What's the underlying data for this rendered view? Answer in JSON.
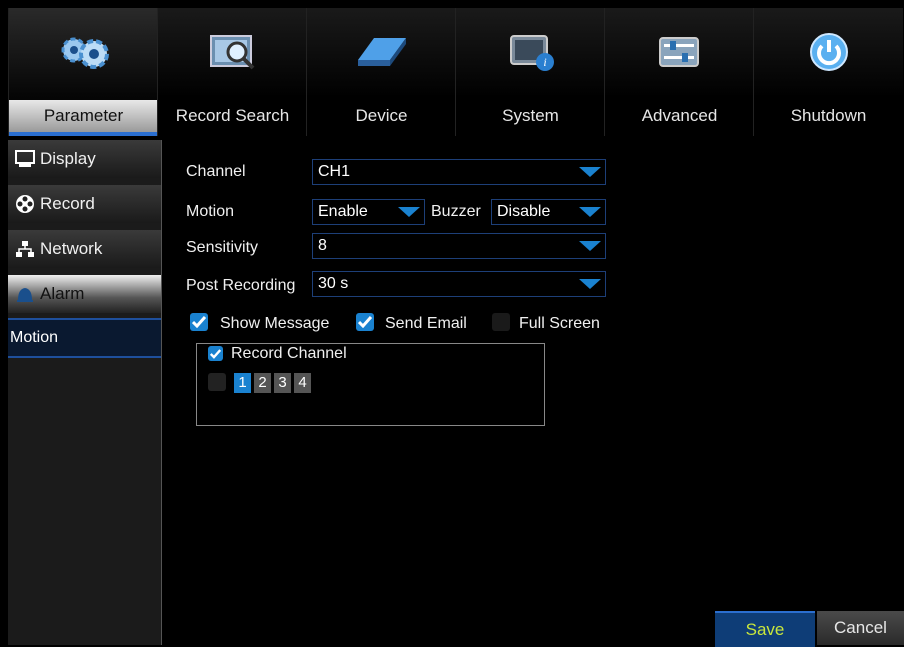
{
  "tabs": [
    {
      "label": "Parameter",
      "icon": "gears-icon",
      "active": true
    },
    {
      "label": "Record Search",
      "icon": "film-search-icon"
    },
    {
      "label": "Device",
      "icon": "hard-drive-icon"
    },
    {
      "label": "System",
      "icon": "system-info-icon"
    },
    {
      "label": "Advanced",
      "icon": "sliders-icon"
    },
    {
      "label": "Shutdown",
      "icon": "power-icon"
    }
  ],
  "sidebar": {
    "items": [
      {
        "label": "Display",
        "icon": "monitor-icon"
      },
      {
        "label": "Record",
        "icon": "film-reel-icon"
      },
      {
        "label": "Network",
        "icon": "network-icon"
      },
      {
        "label": "Alarm",
        "icon": "alarm-bell-icon",
        "active": true
      }
    ],
    "sub_item": "Motion"
  },
  "form": {
    "channel_label": "Channel",
    "channel_value": "CH1",
    "motion_label": "Motion",
    "motion_value": "Enable",
    "buzzer_label": "Buzzer",
    "buzzer_value": "Disable",
    "sensitivity_label": "Sensitivity",
    "sensitivity_value": "8",
    "post_recording_label": "Post Recording",
    "post_recording_value": "30 s",
    "show_message_label": "Show Message",
    "show_message_checked": true,
    "send_email_label": "Send Email",
    "send_email_checked": true,
    "full_screen_label": "Full Screen",
    "full_screen_checked": false,
    "record_channel_label": "Record Channel",
    "record_channel_checked": true,
    "all_channels_checked": false,
    "channels": [
      "1",
      "2",
      "3",
      "4"
    ],
    "selected_channel": "1"
  },
  "buttons": {
    "save": "Save",
    "cancel": "Cancel"
  },
  "colors": {
    "accent_blue": "#1a82d0",
    "save_text": "#c8e63c"
  }
}
